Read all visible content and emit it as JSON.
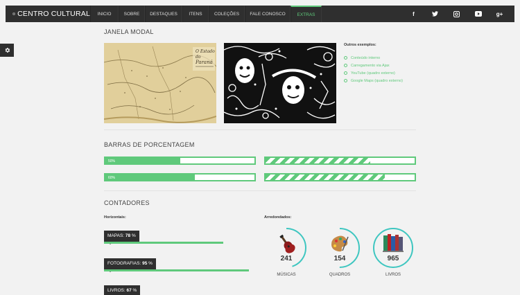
{
  "brand": {
    "name": "CENTRO CULTURAL"
  },
  "nav": {
    "items": [
      {
        "label": "INICIO"
      },
      {
        "label": "SOBRE"
      },
      {
        "label": "DESTAQUES"
      },
      {
        "label": "ITENS"
      },
      {
        "label": "COLEÇÕES"
      },
      {
        "label": "FALE CONOSCO"
      },
      {
        "label": "EXTRAS"
      }
    ],
    "active_index": 6,
    "social": [
      {
        "icon": "facebook-icon",
        "glyph": "f"
      },
      {
        "icon": "twitter-icon",
        "glyph": "🐦"
      },
      {
        "icon": "instagram-icon",
        "glyph": "◙"
      },
      {
        "icon": "youtube-icon",
        "glyph": "▶"
      },
      {
        "icon": "google-plus-icon",
        "glyph": "g+"
      }
    ]
  },
  "modal_section": {
    "title": "JANELA MODAL",
    "examples_title": "Outros exemplos:",
    "examples": [
      "Conteúdo interno",
      "Carregamento via Ajax",
      "YouTube (quadro externo)",
      "Google Maps (quadro externo)"
    ]
  },
  "bars_section": {
    "title": "BARRAS DE PORCENTAGEM",
    "bars": [
      {
        "label": "50%",
        "value": 50,
        "striped": false
      },
      {
        "label": "",
        "value": 70,
        "striped": true
      },
      {
        "label": "60%",
        "value": 60,
        "striped": false
      },
      {
        "label": "",
        "value": 80,
        "striped": true
      }
    ]
  },
  "counters_section": {
    "title": "CONTADORES",
    "horizontal_label": "Horizontais:",
    "rounded_label": "Arredondados:",
    "horizontal": [
      {
        "label": "MAPAS:",
        "value": "78",
        "unit": "%",
        "percent": 78
      },
      {
        "label": "FOTOGRAFIAS:",
        "value": "95",
        "unit": "%",
        "percent": 95
      },
      {
        "label": "LIVROS:",
        "value": "67",
        "unit": "%",
        "percent": 67
      }
    ],
    "rounded": [
      {
        "number": "241",
        "label": "MÚSICAS",
        "fraction": 0.45
      },
      {
        "number": "154",
        "label": "QUADROS",
        "fraction": 0.5
      },
      {
        "number": "965",
        "label": "LIVROS",
        "fraction": 1.0
      }
    ]
  },
  "colors": {
    "accent": "#5fc97b",
    "teal": "#3ec6c0",
    "dark": "#2f2f2f"
  }
}
